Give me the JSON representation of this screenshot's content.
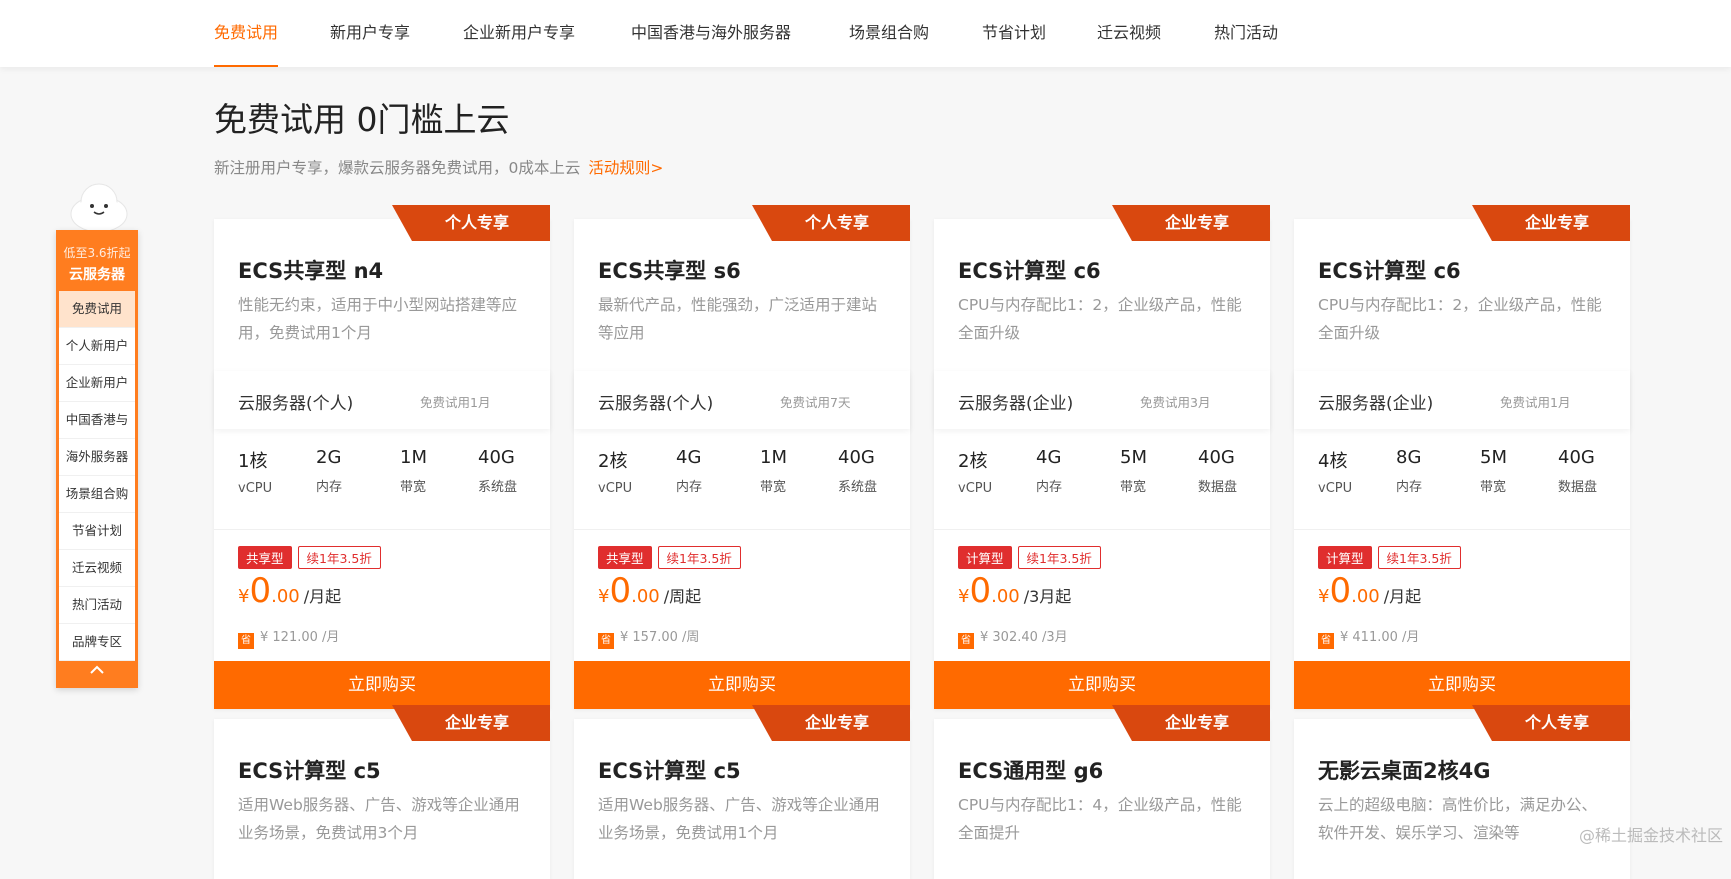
{
  "nav": {
    "tabs": [
      {
        "label": "免费试用",
        "active": true
      },
      {
        "label": "新用户专享"
      },
      {
        "label": "企业新用户专享"
      },
      {
        "label": "中国香港与海外服务器"
      },
      {
        "label": "场景组合购"
      },
      {
        "label": "节省计划"
      },
      {
        "label": "迁云视频"
      },
      {
        "label": "热门活动"
      }
    ]
  },
  "header": {
    "title": "免费试用 0门槛上云",
    "subtitle": "新注册用户专享，爆款云服务器免费试用，0成本上云",
    "rules_link": "活动规则>"
  },
  "sidebar": {
    "promo_line1": "低至3.6折起",
    "promo_line2": "云服务器",
    "items": [
      "免费试用",
      "个人新用户",
      "企业新用户",
      "中国香港与",
      "海外服务器",
      "场景组合购",
      "节省计划",
      "迁云视频",
      "热门活动",
      "品牌专区"
    ],
    "up_icon": "^"
  },
  "cards": [
    {
      "ribbon": "个人专享",
      "title": "ECS共享型 n4",
      "desc": "性能无约束，适用于中小型网站搭建等应用，免费试用1个月",
      "spec_name": "云服务器(个人)",
      "spec_trial": "免费试用1月",
      "specs": [
        {
          "value": "1核",
          "label": "vCPU"
        },
        {
          "value": "2G",
          "label": "内存"
        },
        {
          "value": "1M",
          "label": "带宽"
        },
        {
          "value": "40G",
          "label": "系统盘"
        }
      ],
      "tag1": "共享型",
      "tag2": "续1年3.5折",
      "currency": "¥",
      "price_int": "0",
      "price_dec": ".00",
      "price_unit": "/月起",
      "orig_badge": "省",
      "orig_price": "¥ 121.00 /月",
      "buy": "立即购买"
    },
    {
      "ribbon": "个人专享",
      "title": "ECS共享型 s6",
      "desc": "最新代产品，性能强劲，广泛适用于建站等应用",
      "spec_name": "云服务器(个人)",
      "spec_trial": "免费试用7天",
      "specs": [
        {
          "value": "2核",
          "label": "vCPU"
        },
        {
          "value": "4G",
          "label": "内存"
        },
        {
          "value": "1M",
          "label": "带宽"
        },
        {
          "value": "40G",
          "label": "系统盘"
        }
      ],
      "tag1": "共享型",
      "tag2": "续1年3.5折",
      "currency": "¥",
      "price_int": "0",
      "price_dec": ".00",
      "price_unit": "/周起",
      "orig_badge": "省",
      "orig_price": "¥ 157.00 /周",
      "buy": "立即购买"
    },
    {
      "ribbon": "企业专享",
      "title": "ECS计算型 c6",
      "desc": "CPU与内存配比1：2，企业级产品，性能全面升级",
      "spec_name": "云服务器(企业)",
      "spec_trial": "免费试用3月",
      "specs": [
        {
          "value": "2核",
          "label": "vCPU"
        },
        {
          "value": "4G",
          "label": "内存"
        },
        {
          "value": "5M",
          "label": "带宽"
        },
        {
          "value": "40G",
          "label": "数据盘"
        }
      ],
      "tag1": "计算型",
      "tag2": "续1年3.5折",
      "currency": "¥",
      "price_int": "0",
      "price_dec": ".00",
      "price_unit": "/3月起",
      "orig_badge": "省",
      "orig_price": "¥ 302.40 /3月",
      "buy": "立即购买"
    },
    {
      "ribbon": "企业专享",
      "title": "ECS计算型 c6",
      "desc": "CPU与内存配比1：2，企业级产品，性能全面升级",
      "spec_name": "云服务器(企业)",
      "spec_trial": "免费试用1月",
      "specs": [
        {
          "value": "4核",
          "label": "vCPU"
        },
        {
          "value": "8G",
          "label": "内存"
        },
        {
          "value": "5M",
          "label": "带宽"
        },
        {
          "value": "40G",
          "label": "数据盘"
        }
      ],
      "tag1": "计算型",
      "tag2": "续1年3.5折",
      "currency": "¥",
      "price_int": "0",
      "price_dec": ".00",
      "price_unit": "/月起",
      "orig_badge": "省",
      "orig_price": "¥ 411.00 /月",
      "buy": "立即购买"
    },
    {
      "ribbon": "企业专享",
      "title": "ECS计算型 c5",
      "desc": "适用Web服务器、广告、游戏等企业通用业务场景，免费试用3个月"
    },
    {
      "ribbon": "企业专享",
      "title": "ECS计算型 c5",
      "desc": "适用Web服务器、广告、游戏等企业通用业务场景，免费试用1个月"
    },
    {
      "ribbon": "企业专享",
      "title": "ECS通用型 g6",
      "desc": "CPU与内存配比1：4，企业级产品，性能全面提升"
    },
    {
      "ribbon": "个人专享",
      "title": "无影云桌面2核4G",
      "desc": "云上的超级电脑：高性价比，满足办公、软件开发、娱乐学习、渲染等"
    }
  ],
  "watermark": "@稀土掘金技术社区",
  "colors": {
    "accent": "#ff6a00",
    "ribbon": "#d9480f",
    "tag_red": "#e02e2e"
  }
}
